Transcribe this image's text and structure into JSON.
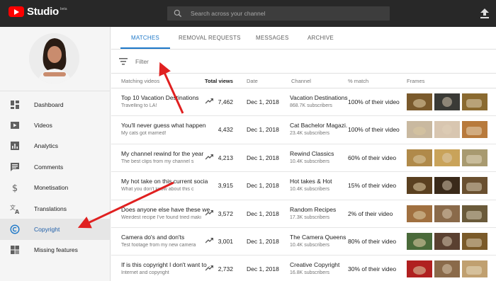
{
  "app": {
    "logo_text": "Studio",
    "logo_badge": "beta",
    "search_placeholder": "Search across your channel"
  },
  "sidebar": {
    "items": [
      {
        "label": "Dashboard",
        "icon": "dashboard-icon",
        "active": false
      },
      {
        "label": "Videos",
        "icon": "videos-icon",
        "active": false
      },
      {
        "label": "Analytics",
        "icon": "analytics-icon",
        "active": false
      },
      {
        "label": "Comments",
        "icon": "comments-icon",
        "active": false
      },
      {
        "label": "Monetisation",
        "icon": "dollar-icon",
        "active": false
      },
      {
        "label": "Translations",
        "icon": "translate-icon",
        "active": false
      },
      {
        "label": "Copyright",
        "icon": "copyright-icon",
        "active": true
      },
      {
        "label": "Missing features",
        "icon": "missing-features-icon",
        "active": false
      }
    ]
  },
  "tabs": [
    "MATCHES",
    "REMOVAL REQUESTS",
    "MESSAGES",
    "ARCHIVE"
  ],
  "filter": {
    "placeholder": "Filter"
  },
  "table": {
    "headers": [
      "Matching videos",
      "Total views",
      "Date",
      "Channel",
      "% match",
      "Frames"
    ],
    "rows": [
      {
        "title": "Top 10 Vacation Destinations",
        "subtitle": "Travelling to LA!",
        "views": "7,462",
        "trending": true,
        "date": "Dec 1, 2018",
        "channel": "Vacation Destinations",
        "subscribers": "868.7K subscribers",
        "match": "100% of their video"
      },
      {
        "title": "You'll never guess what happen",
        "subtitle": "My cats got married!",
        "views": "4,432",
        "trending": false,
        "date": "Dec 1, 2018",
        "channel": "Cat Bachelor Magazi...",
        "subscribers": "23.4K subscribers",
        "match": "100% of their video"
      },
      {
        "title": "My channel rewind for the year",
        "subtitle": "The best clips from my channel s",
        "views": "4,213",
        "trending": true,
        "date": "Dec 1, 2018",
        "channel": "Rewind Classics",
        "subscribers": "10.4K subscribers",
        "match": "60% of their video"
      },
      {
        "title": "My hot take on this current socia",
        "subtitle": "What you don't know about this c",
        "views": "3,915",
        "trending": false,
        "date": "Dec 1, 2018",
        "channel": "Hot takes & Hot",
        "subscribers": "10.4K subscribers",
        "match": "15% of their video"
      },
      {
        "title": "Does anyone else have these wei...",
        "subtitle": "Weirdest recipe I've found tried maki",
        "views": "3,572",
        "trending": true,
        "date": "Dec 1, 2018",
        "channel": "Random Recipes",
        "subscribers": "17.3K subscribers",
        "match": "2% of their video"
      },
      {
        "title": "Camera do's and don'ts",
        "subtitle": "Test footage from my new camera",
        "views": "3,001",
        "trending": true,
        "date": "Dec 1, 2018",
        "channel": "The Camera Queens",
        "subscribers": "10.4K subscribers",
        "match": "80% of their video"
      },
      {
        "title": "If is this copyright I don't want to ...",
        "subtitle": "Internet and copyright",
        "views": "2,732",
        "trending": true,
        "date": "Dec 1, 2018",
        "channel": "Creative Copyright",
        "subscribers": "16.8K subscribers",
        "match": "30% of their video"
      }
    ]
  },
  "colors": {
    "accent": "#1e78c8",
    "annotation_arrow": "#e02020",
    "topbar": "#282828",
    "brand_red": "#ff0000"
  }
}
